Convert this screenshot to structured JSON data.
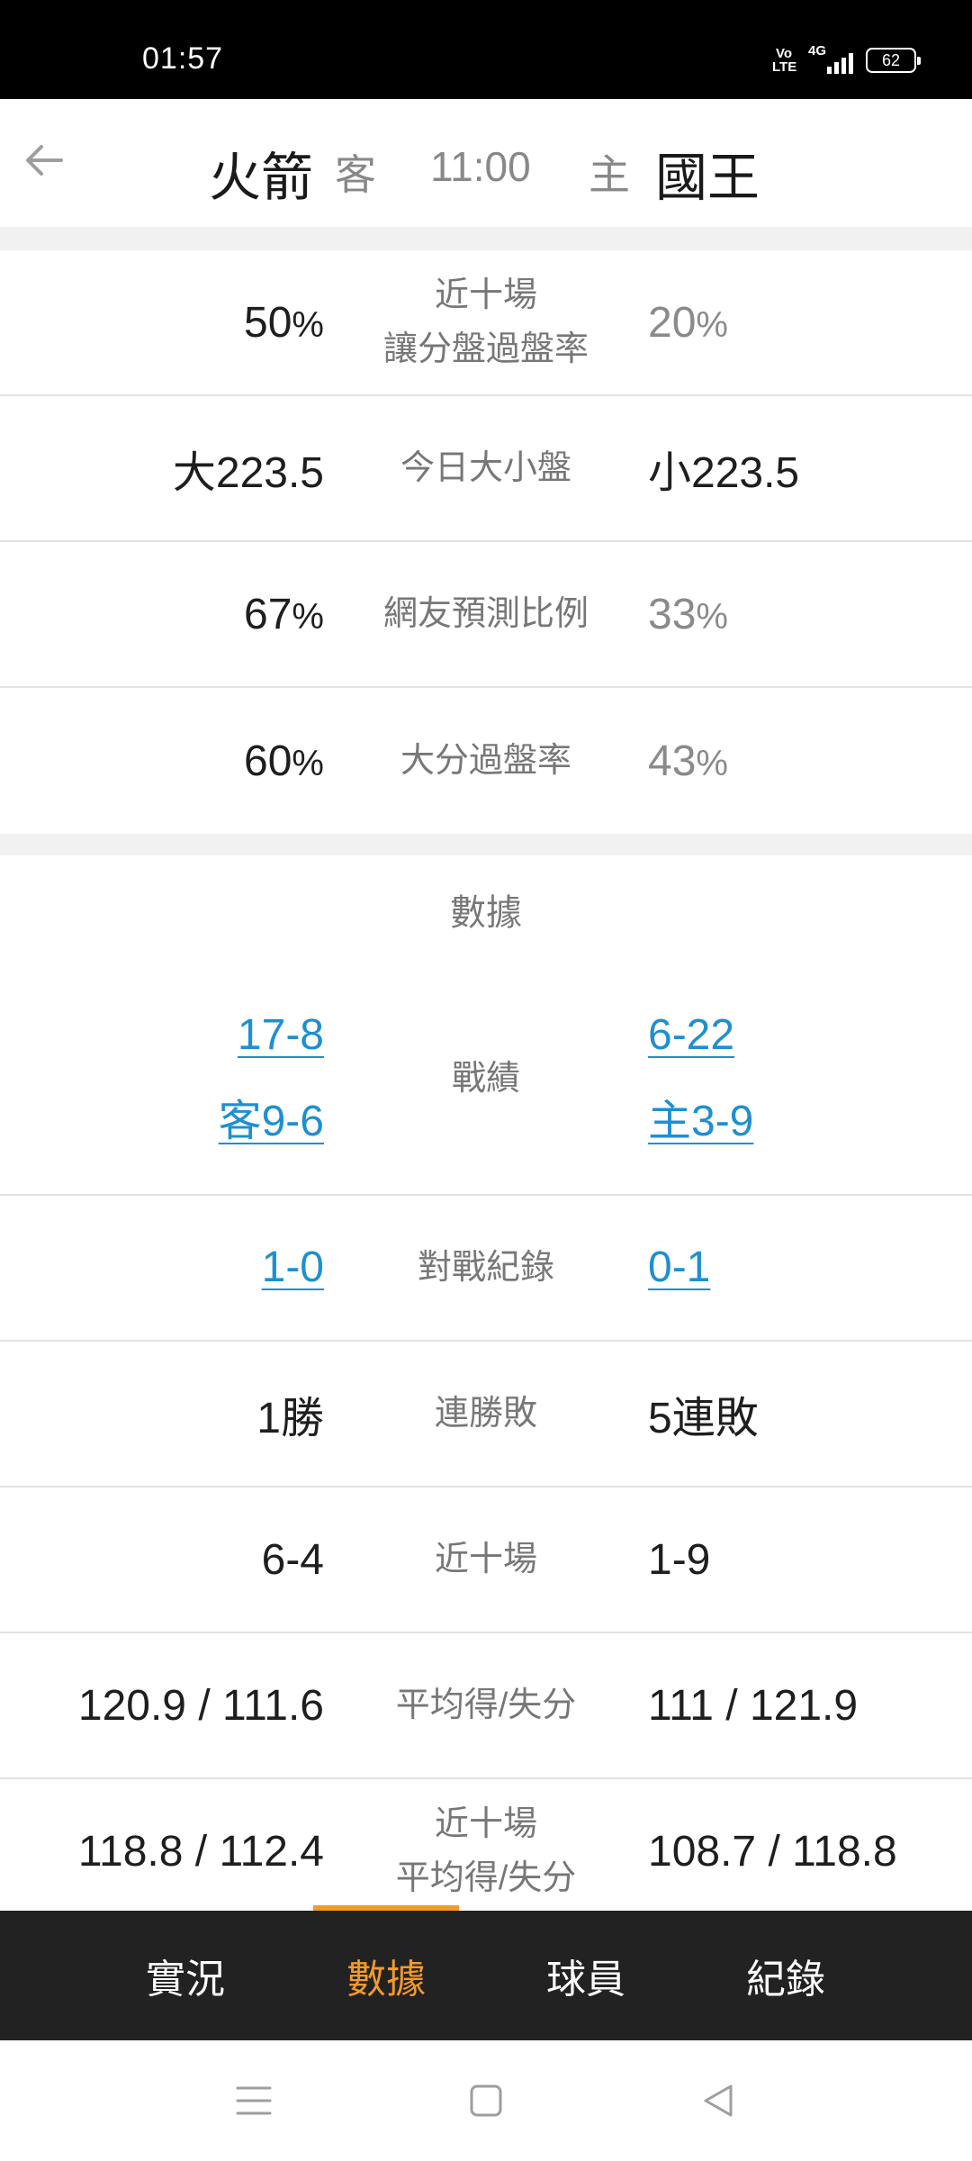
{
  "status_bar": {
    "time": "01:57",
    "volte": "Vo LTE",
    "network": "4G",
    "battery": "62"
  },
  "header": {
    "away_team": "火箭",
    "away_label": "客",
    "game_time": "11:00",
    "home_label": "主",
    "home_team": "國王"
  },
  "betting_rows": [
    {
      "left": "50",
      "left_unit": "%",
      "label_line1": "近十場",
      "label_line2": "讓分盤過盤率",
      "right": "20",
      "right_unit": "%"
    },
    {
      "left": "大223.5",
      "label": "今日大小盤",
      "right": "小223.5"
    },
    {
      "left": "67",
      "left_unit": "%",
      "label": "網友預測比例",
      "right": "33",
      "right_unit": "%"
    },
    {
      "left": "60",
      "left_unit": "%",
      "label": "大分過盤率",
      "right": "43",
      "right_unit": "%"
    }
  ],
  "data_section": {
    "title": "數據",
    "record": {
      "label": "戰績",
      "left_overall": "17-8",
      "left_split": "客9-6",
      "right_overall": "6-22",
      "right_split": "主3-9"
    },
    "head_to_head": {
      "label": "對戰紀錄",
      "left": "1-0",
      "right": "0-1"
    },
    "streak": {
      "label": "連勝敗",
      "left": "1勝",
      "right": "5連敗"
    },
    "last_ten": {
      "label": "近十場",
      "left": "6-4",
      "right": "1-9"
    },
    "avg_points": {
      "label": "平均得/失分",
      "left": "120.9 / 111.6",
      "right": "111 / 121.9"
    },
    "last_ten_avg": {
      "label_line1": "近十場",
      "label_line2": "平均得/失分",
      "left": "118.8 / 112.4",
      "right": "108.7 / 118.8"
    }
  },
  "tabs": [
    {
      "label": "實況",
      "active": false
    },
    {
      "label": "數據",
      "active": true
    },
    {
      "label": "球員",
      "active": false
    },
    {
      "label": "紀錄",
      "active": false
    }
  ],
  "colors": {
    "accent": "#f39a2a",
    "link": "#1f8fd0",
    "tab_bar": "#222222"
  },
  "icons": {
    "back": "arrow-left-icon",
    "nav_menu": "menu-icon",
    "nav_home": "home-square-icon",
    "nav_back": "triangle-back-icon"
  }
}
